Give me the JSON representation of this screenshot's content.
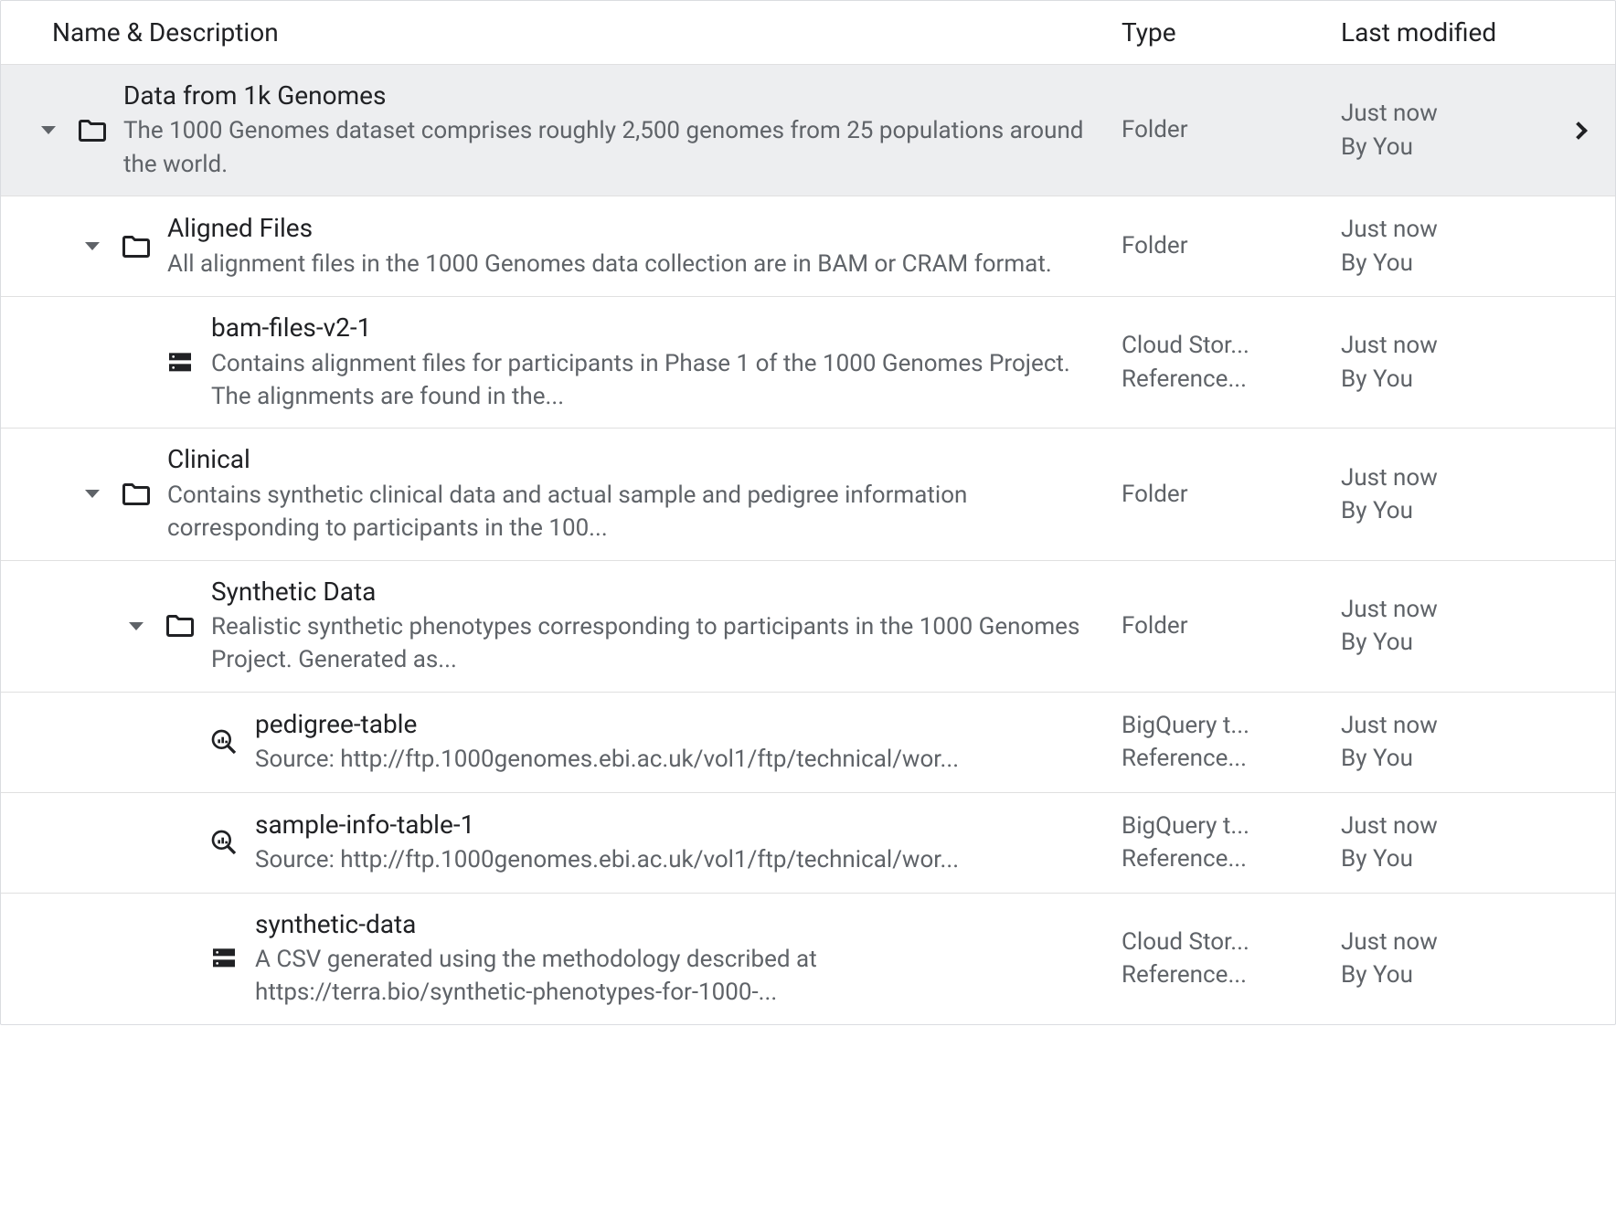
{
  "columns": {
    "name": "Name & Description",
    "type": "Type",
    "modified": "Last modified"
  },
  "rows": [
    {
      "indent": 0,
      "expandable": true,
      "selected": true,
      "icon": "folder",
      "title": "Data from 1k Genomes",
      "desc": "The 1000 Genomes dataset comprises roughly 2,500 genomes from 25 populations around the world.",
      "type": "Folder",
      "type_sub": "",
      "modified": "Just now",
      "by": "By You",
      "chevron": true
    },
    {
      "indent": 1,
      "expandable": true,
      "selected": false,
      "icon": "folder",
      "title": "Aligned Files",
      "desc": "All alignment files in the 1000 Genomes data collection are in BAM or CRAM format.",
      "type": "Folder",
      "type_sub": "",
      "modified": "Just now",
      "by": "By You",
      "chevron": false
    },
    {
      "indent": 2,
      "expandable": false,
      "selected": false,
      "icon": "storage",
      "title": "bam-files-v2-1",
      "desc": "Contains alignment files for participants in Phase 1 of the 1000 Genomes Project. The alignments are found in the...",
      "type": "Cloud Stor...",
      "type_sub": "Reference...",
      "modified": "Just now",
      "by": "By You",
      "chevron": false
    },
    {
      "indent": 1,
      "expandable": true,
      "selected": false,
      "icon": "folder",
      "title": "Clinical",
      "desc": "Contains synthetic clinical data and actual sample and pedigree information corresponding to participants in the 100...",
      "type": "Folder",
      "type_sub": "",
      "modified": "Just now",
      "by": "By You",
      "chevron": false
    },
    {
      "indent": 2,
      "expandable": true,
      "selected": false,
      "icon": "folder",
      "title": "Synthetic Data",
      "desc": "Realistic synthetic phenotypes corresponding to participants in the 1000 Genomes Project. Generated as...",
      "type": "Folder",
      "type_sub": "",
      "modified": "Just now",
      "by": "By You",
      "chevron": false
    },
    {
      "indent": 3,
      "expandable": false,
      "selected": false,
      "icon": "bigquery",
      "title": "pedigree-table",
      "desc": "Source: http://ftp.1000genomes.ebi.ac.uk/vol1/ftp/technical/wor...",
      "type": "BigQuery t...",
      "type_sub": "Reference...",
      "modified": "Just now",
      "by": "By You",
      "chevron": false
    },
    {
      "indent": 3,
      "expandable": false,
      "selected": false,
      "icon": "bigquery",
      "title": "sample-info-table-1",
      "desc": "Source: http://ftp.1000genomes.ebi.ac.uk/vol1/ftp/technical/wor...",
      "type": "BigQuery t...",
      "type_sub": "Reference...",
      "modified": "Just now",
      "by": "By You",
      "chevron": false
    },
    {
      "indent": 3,
      "expandable": false,
      "selected": false,
      "icon": "storage",
      "title": "synthetic-data",
      "desc": "A CSV generated using the methodology described at https://terra.bio/synthetic-phenotypes-for-1000-...",
      "type": "Cloud Stor...",
      "type_sub": "Reference...",
      "modified": "Just now",
      "by": "By You",
      "chevron": false
    }
  ]
}
